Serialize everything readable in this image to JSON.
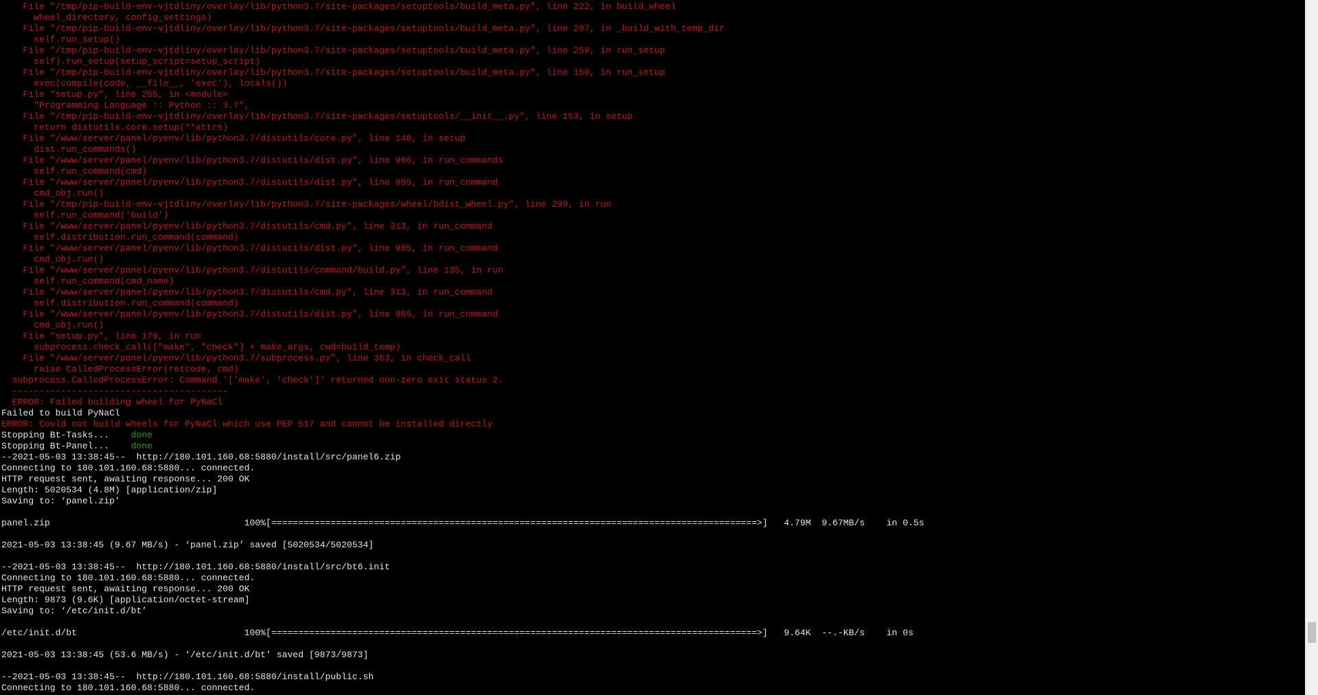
{
  "colors": {
    "background": "#000000",
    "error": "#c50f1f",
    "normal": "#e6e6e6",
    "ok": "#13a10e"
  },
  "terminal": {
    "lines": [
      [
        {
          "t": "    File \"/tmp/pip-build-env-vjtdliny/overlay/lib/python3.7/site-packages/setuptools/build_meta.py\", line 222, in build_wheel",
          "c": "red"
        }
      ],
      [
        {
          "t": "      wheel_directory, config_settings)",
          "c": "red"
        }
      ],
      [
        {
          "t": "    File \"/tmp/pip-build-env-vjtdliny/overlay/lib/python3.7/site-packages/setuptools/build_meta.py\", line 207, in _build_with_temp_dir",
          "c": "red"
        }
      ],
      [
        {
          "t": "      self.run_setup()",
          "c": "red"
        }
      ],
      [
        {
          "t": "    File \"/tmp/pip-build-env-vjtdliny/overlay/lib/python3.7/site-packages/setuptools/build_meta.py\", line 259, in run_setup",
          "c": "red"
        }
      ],
      [
        {
          "t": "      self).run_setup(setup_script=setup_script)",
          "c": "red"
        }
      ],
      [
        {
          "t": "    File \"/tmp/pip-build-env-vjtdliny/overlay/lib/python3.7/site-packages/setuptools/build_meta.py\", line 150, in run_setup",
          "c": "red"
        }
      ],
      [
        {
          "t": "      exec(compile(code, __file__, 'exec'), locals())",
          "c": "red"
        }
      ],
      [
        {
          "t": "    File \"setup.py\", line 255, in <module>",
          "c": "red"
        }
      ],
      [
        {
          "t": "      \"Programming Language :: Python :: 3.7\",",
          "c": "red"
        }
      ],
      [
        {
          "t": "    File \"/tmp/pip-build-env-vjtdliny/overlay/lib/python3.7/site-packages/setuptools/__init__.py\", line 153, in setup",
          "c": "red"
        }
      ],
      [
        {
          "t": "      return distutils.core.setup(**attrs)",
          "c": "red"
        }
      ],
      [
        {
          "t": "    File \"/www/server/panel/pyenv/lib/python3.7/distutils/core.py\", line 148, in setup",
          "c": "red"
        }
      ],
      [
        {
          "t": "      dist.run_commands()",
          "c": "red"
        }
      ],
      [
        {
          "t": "    File \"/www/server/panel/pyenv/lib/python3.7/distutils/dist.py\", line 966, in run_commands",
          "c": "red"
        }
      ],
      [
        {
          "t": "      self.run_command(cmd)",
          "c": "red"
        }
      ],
      [
        {
          "t": "    File \"/www/server/panel/pyenv/lib/python3.7/distutils/dist.py\", line 985, in run_command",
          "c": "red"
        }
      ],
      [
        {
          "t": "      cmd_obj.run()",
          "c": "red"
        }
      ],
      [
        {
          "t": "    File \"/tmp/pip-build-env-vjtdliny/overlay/lib/python3.7/site-packages/wheel/bdist_wheel.py\", line 299, in run",
          "c": "red"
        }
      ],
      [
        {
          "t": "      self.run_command('build')",
          "c": "red"
        }
      ],
      [
        {
          "t": "    File \"/www/server/panel/pyenv/lib/python3.7/distutils/cmd.py\", line 313, in run_command",
          "c": "red"
        }
      ],
      [
        {
          "t": "      self.distribution.run_command(command)",
          "c": "red"
        }
      ],
      [
        {
          "t": "    File \"/www/server/panel/pyenv/lib/python3.7/distutils/dist.py\", line 985, in run_command",
          "c": "red"
        }
      ],
      [
        {
          "t": "      cmd_obj.run()",
          "c": "red"
        }
      ],
      [
        {
          "t": "    File \"/www/server/panel/pyenv/lib/python3.7/distutils/command/build.py\", line 135, in run",
          "c": "red"
        }
      ],
      [
        {
          "t": "      self.run_command(cmd_name)",
          "c": "red"
        }
      ],
      [
        {
          "t": "    File \"/www/server/panel/pyenv/lib/python3.7/distutils/cmd.py\", line 313, in run_command",
          "c": "red"
        }
      ],
      [
        {
          "t": "      self.distribution.run_command(command)",
          "c": "red"
        }
      ],
      [
        {
          "t": "    File \"/www/server/panel/pyenv/lib/python3.7/distutils/dist.py\", line 985, in run_command",
          "c": "red"
        }
      ],
      [
        {
          "t": "      cmd_obj.run()",
          "c": "red"
        }
      ],
      [
        {
          "t": "    File \"setup.py\", line 179, in run",
          "c": "red"
        }
      ],
      [
        {
          "t": "      subprocess.check_call([\"make\", \"check\"] + make_args, cwd=build_temp)",
          "c": "red"
        }
      ],
      [
        {
          "t": "    File \"/www/server/panel/pyenv/lib/python3.7/subprocess.py\", line 363, in check_call",
          "c": "red"
        }
      ],
      [
        {
          "t": "      raise CalledProcessError(retcode, cmd)",
          "c": "red"
        }
      ],
      [
        {
          "t": "  subprocess.CalledProcessError: Command '['make', 'check']' returned non-zero exit status 2.",
          "c": "red"
        }
      ],
      [
        {
          "t": "  ----------------------------------------",
          "c": "red"
        }
      ],
      [
        {
          "t": "  ERROR: Failed building wheel for PyNaCl",
          "c": "red"
        }
      ],
      [
        {
          "t": "Failed to build PyNaCl",
          "c": "white"
        }
      ],
      [
        {
          "t": "ERROR: Could not build wheels for PyNaCl which use PEP 517 and cannot be installed directly",
          "c": "red"
        }
      ],
      [
        {
          "t": "Stopping Bt-Tasks...    ",
          "c": "white"
        },
        {
          "t": "done",
          "c": "green"
        }
      ],
      [
        {
          "t": "Stopping Bt-Panel...    ",
          "c": "white"
        },
        {
          "t": "done",
          "c": "green"
        }
      ],
      [
        {
          "t": "--2021-05-03 13:38:45--  http://180.101.160.68:5880/install/src/panel6.zip",
          "c": "white"
        }
      ],
      [
        {
          "t": "Connecting to 180.101.160.68:5880... connected.",
          "c": "white"
        }
      ],
      [
        {
          "t": "HTTP request sent, awaiting response... 200 OK",
          "c": "white"
        }
      ],
      [
        {
          "t": "Length: 5020534 (4.8M) [application/zip]",
          "c": "white"
        }
      ],
      [
        {
          "t": "Saving to: ‘panel.zip’",
          "c": "white"
        }
      ],
      [
        {
          "t": "",
          "c": "white"
        }
      ],
      [
        {
          "t": "panel.zip                                    100%[==========================================================================================>]   4.79M  9.67MB/s    in 0.5s",
          "c": "white"
        }
      ],
      [
        {
          "t": "",
          "c": "white"
        }
      ],
      [
        {
          "t": "2021-05-03 13:38:45 (9.67 MB/s) - ‘panel.zip’ saved [5020534/5020534]",
          "c": "white"
        }
      ],
      [
        {
          "t": "",
          "c": "white"
        }
      ],
      [
        {
          "t": "--2021-05-03 13:38:45--  http://180.101.160.68:5880/install/src/bt6.init",
          "c": "white"
        }
      ],
      [
        {
          "t": "Connecting to 180.101.160.68:5880... connected.",
          "c": "white"
        }
      ],
      [
        {
          "t": "HTTP request sent, awaiting response... 200 OK",
          "c": "white"
        }
      ],
      [
        {
          "t": "Length: 9873 (9.6K) [application/octet-stream]",
          "c": "white"
        }
      ],
      [
        {
          "t": "Saving to: ‘/etc/init.d/bt’",
          "c": "white"
        }
      ],
      [
        {
          "t": "",
          "c": "white"
        }
      ],
      [
        {
          "t": "/etc/init.d/bt                               100%[==========================================================================================>]   9.64K  --.-KB/s    in 0s",
          "c": "white"
        }
      ],
      [
        {
          "t": "",
          "c": "white"
        }
      ],
      [
        {
          "t": "2021-05-03 13:38:45 (53.6 MB/s) - ‘/etc/init.d/bt’ saved [9873/9873]",
          "c": "white"
        }
      ],
      [
        {
          "t": "",
          "c": "white"
        }
      ],
      [
        {
          "t": "--2021-05-03 13:38:45--  http://180.101.160.68:5880/install/public.sh",
          "c": "white"
        }
      ],
      [
        {
          "t": "Connecting to 180.101.160.68:5880... connected.",
          "c": "white"
        }
      ]
    ]
  }
}
